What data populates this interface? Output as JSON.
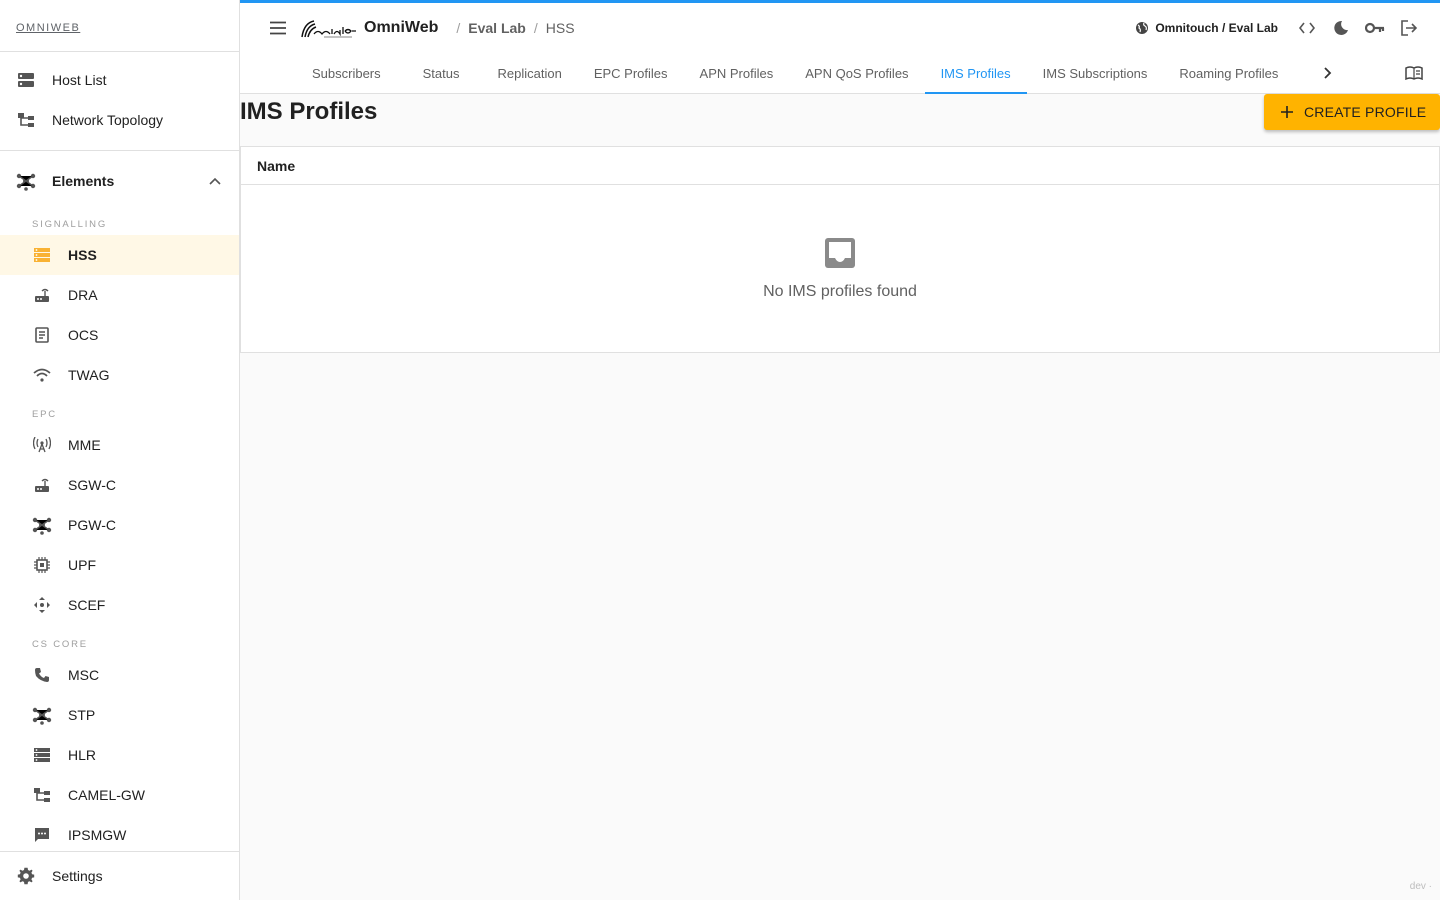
{
  "sidebar": {
    "brand": "OMNIWEB",
    "top_items": [
      {
        "label": "Host List"
      },
      {
        "label": "Network Topology"
      }
    ],
    "group": {
      "label": "Elements"
    },
    "sections": [
      {
        "label": "SIGNALLING",
        "items": [
          "HSS",
          "DRA",
          "OCS",
          "TWAG"
        ]
      },
      {
        "label": "EPC",
        "items": [
          "MME",
          "SGW-C",
          "PGW-C",
          "UPF",
          "SCEF"
        ]
      },
      {
        "label": "CS CORE",
        "items": [
          "MSC",
          "STP",
          "HLR",
          "CAMEL-GW",
          "IPSMGW"
        ]
      }
    ],
    "active_item": "HSS",
    "settings_label": "Settings"
  },
  "header": {
    "app_name": "OmniWeb",
    "breadcrumb": [
      "Eval Lab",
      "HSS"
    ],
    "tenant": "Omnitouch / Eval Lab"
  },
  "tabs": [
    "Subscribers",
    "Status",
    "Replication",
    "EPC Profiles",
    "APN Profiles",
    "APN QoS Profiles",
    "IMS Profiles",
    "IMS Subscriptions",
    "Roaming Profiles"
  ],
  "active_tab": "IMS Profiles",
  "main": {
    "title": "IMS Profiles",
    "create_label": "CREATE PROFILE",
    "table": {
      "columns": [
        "Name"
      ],
      "empty_text": "No IMS profiles found"
    }
  },
  "footer": {
    "env": "dev ·"
  },
  "colors": {
    "accent": "#2196f3",
    "primary_button": "#ffb300",
    "active_nav_bg": "#fff8e6",
    "active_nav_icon": "#f9b233"
  }
}
